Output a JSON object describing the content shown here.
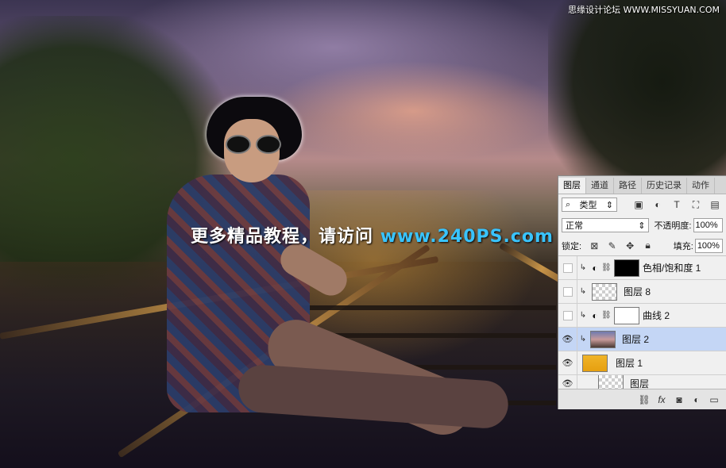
{
  "watermark": {
    "text": "更多精品教程，请访问",
    "url": "www.240PS.com"
  },
  "site_mark": "思缘设计论坛 WWW.MISSYUAN.COM",
  "panel": {
    "tabs": [
      "图层",
      "通道",
      "路径",
      "历史记录",
      "动作"
    ],
    "filter": {
      "label": "类型"
    },
    "blend_mode": "正常",
    "opacity_label": "不透明度:",
    "opacity_value": "100%",
    "lock_label": "锁定:",
    "fill_label": "填充:",
    "fill_value": "100%",
    "layers": [
      {
        "name": "色相/饱和度 1",
        "visible": false
      },
      {
        "name": "图层 8",
        "visible": false
      },
      {
        "name": "曲线 2",
        "visible": false
      },
      {
        "name": "图层 2",
        "visible": true,
        "selected": true
      },
      {
        "name": "图层 1",
        "visible": true
      },
      {
        "name": "图层",
        "visible": true
      }
    ]
  }
}
